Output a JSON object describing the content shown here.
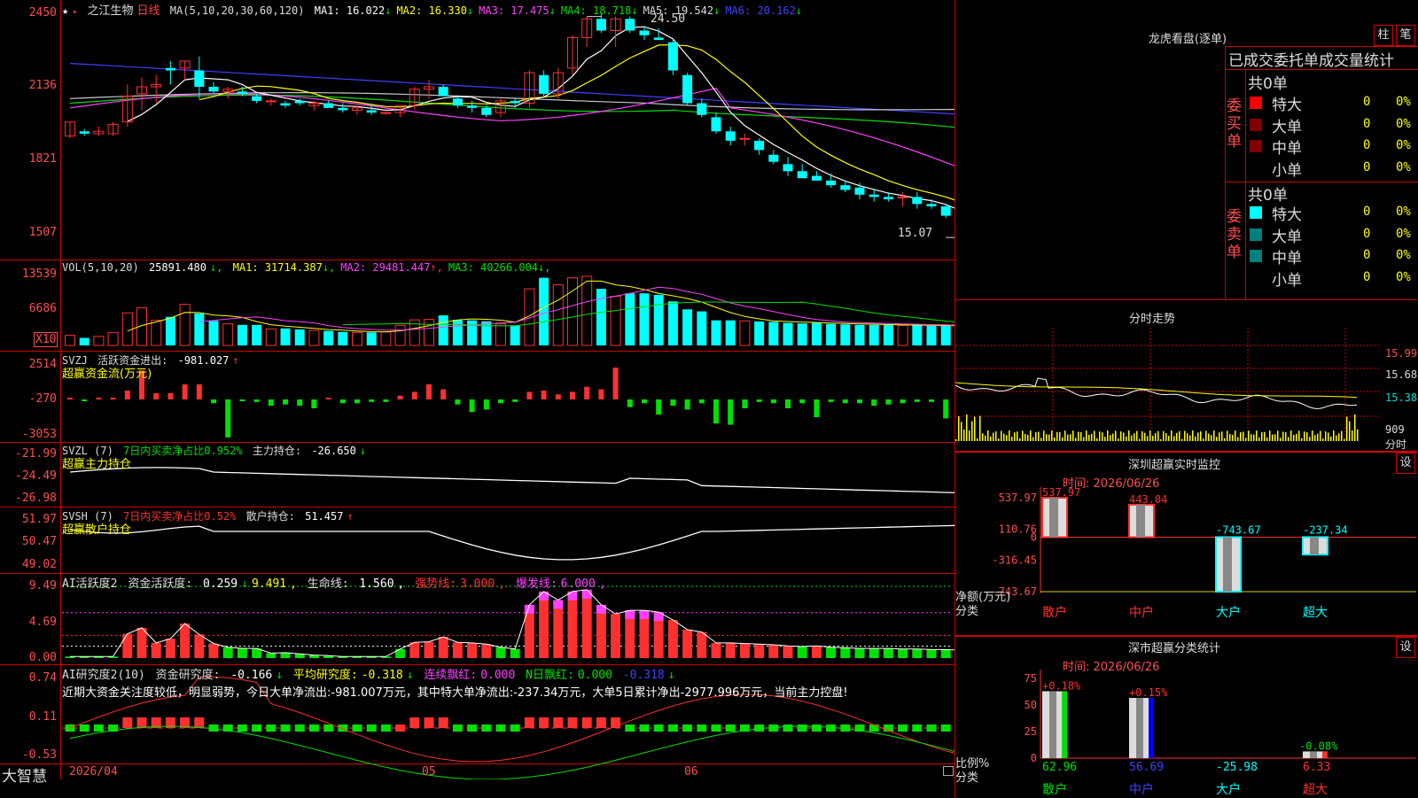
{
  "stock": {
    "name": "之江生物",
    "period": "日线"
  },
  "colors": {
    "up": "#ff3030",
    "down": "#00ffff",
    "green": "#00e000",
    "yellow": "#ffff00",
    "magenta": "#ff40ff",
    "white": "#ffffff",
    "grid": "#cc0000",
    "ma6": "#4040ff"
  },
  "price_panel": {
    "ma_label": "MA(5,10,20,30,60,120)",
    "ma": [
      {
        "name": "MA1:",
        "value": "16.022",
        "arrow": "↓",
        "color": "#ffffff"
      },
      {
        "name": "MA2:",
        "value": "16.330",
        "arrow": "↓",
        "color": "#ffff00"
      },
      {
        "name": "MA3:",
        "value": "17.475",
        "arrow": "↓",
        "color": "#ff40ff"
      },
      {
        "name": "MA4:",
        "value": "18.718",
        "arrow": "↓",
        "color": "#00e000"
      },
      {
        "name": "MA5:",
        "value": "19.542",
        "arrow": "↓",
        "color": "#dddddd"
      },
      {
        "name": "MA6:",
        "value": "20.162",
        "arrow": "↓",
        "color": "#4040ff"
      }
    ],
    "y_ticks": [
      "2450",
      "2136",
      "1821",
      "1507"
    ],
    "high_label": "24.50",
    "low_label": "15.07"
  },
  "vol_panel": {
    "label": "VOL(5,10,20)",
    "value": "25891.480",
    "ma": [
      {
        "name": "MA1:",
        "value": "31714.387",
        "arrow": "↓",
        "color": "#ffff00"
      },
      {
        "name": "MA2:",
        "value": "29481.447",
        "arrow": "↑",
        "color": "#ff40ff"
      },
      {
        "name": "MA3:",
        "value": "40266.004",
        "arrow": "↓",
        "color": "#00e000"
      }
    ],
    "y_ticks": [
      "13539",
      "6686"
    ],
    "unit": "X10"
  },
  "svzj_panel": {
    "label": "SVZJ",
    "name": "活跃资金进出:",
    "value": "-981.027",
    "arrow": "↑",
    "subtitle": "超赢资金流(万元)",
    "y_ticks": [
      "2514",
      "-270",
      "-3053"
    ]
  },
  "svzl_panel": {
    "label": "SVZL (7)",
    "name": "7日内买卖净占比0.952%",
    "name2": "主力持仓:",
    "value": "-26.650",
    "arrow": "↓",
    "subtitle": "超赢主力持仓",
    "y_ticks": [
      "-21.99",
      "-24.49",
      "-26.98"
    ]
  },
  "svsh_panel": {
    "label": "SVSH (7)",
    "name": "7日内买卖净占比0.52%",
    "name2": "散户持仓:",
    "value": "51.457",
    "arrow": "↑",
    "subtitle": "超赢散户持仓",
    "y_ticks": [
      "51.97",
      "50.47",
      "49.02"
    ]
  },
  "ai2_panel": {
    "label": "AI活跃度2",
    "name": "资金活跃度:",
    "value": "0.259",
    "arrow": "↓",
    "v2": "9.491",
    "name3": "生命线:",
    "v3": "1.560",
    "strong": "强势线:",
    "strong_v": "3.000",
    "burst": "爆发线:",
    "burst_v": "6.000",
    "y_ticks": [
      "9.49",
      "4.69",
      "0.00"
    ]
  },
  "ai_research_panel": {
    "label": "AI研究度2(10)",
    "name": "资金研究度:",
    "value": "-0.166",
    "arrow": "↓",
    "avg": "平均研究度:",
    "avg_v": "-0.318",
    "avg_arrow": "↓",
    "red": "连续飘红:",
    "red_v": "0.000",
    "nred": "N日飘红:",
    "nred_v": "0.000",
    "extra": "-0.318",
    "extra_arrow": "↓",
    "text": "近期大资金关注度较低，明显弱势，今日大单净流出:-981.007万元，其中特大单净流出:-237.34万元，大单5日累计净出-2977.996万元，当前主力控盘!",
    "y_ticks": [
      "0.74",
      "0.11",
      "-0.53"
    ]
  },
  "date_axis": {
    "d1": "2026/04",
    "d2": "05",
    "d3": "06"
  },
  "brand": "大智慧",
  "longhu": {
    "title": "龙虎看盘(逐单)",
    "btn1": "柱",
    "btn2": "笔",
    "subtitle": "已成交委托单成交量统计",
    "buy_side": "委买单",
    "sell_side": "委卖单",
    "buy_total": "共0单",
    "sell_total": "共0单",
    "rows": [
      "特大",
      "大单",
      "中单",
      "小单"
    ],
    "buy_colors": [
      "#ff0000",
      "#800000",
      "#800000",
      "#000000"
    ],
    "sell_colors": [
      "#00ffff",
      "#008080",
      "#008080",
      "#000000"
    ],
    "count": "0",
    "pct": "0%"
  },
  "minute": {
    "title": "分时走势",
    "prices": [
      "15.99",
      "15.68",
      "15.38"
    ],
    "vol": "909",
    "label": "分时"
  },
  "sz_monitor": {
    "title": "深圳超赢实时监控",
    "btn": "设",
    "time": "时间: 2026/06/26",
    "y_ticks": [
      "537.97",
      "110.76",
      "0",
      "-316.45",
      "-743.67"
    ],
    "bars": [
      {
        "cat": "散户",
        "value": 537.97,
        "label": "537.97"
      },
      {
        "cat": "中户",
        "value": 443.04,
        "label": "443.04"
      },
      {
        "cat": "大户",
        "value": -743.67,
        "label": "-743.67"
      },
      {
        "cat": "超大",
        "value": -237.34,
        "label": "-237.34"
      }
    ],
    "ylabel": "净额(万元)",
    "xlabel": "分类"
  },
  "sz_class": {
    "title": "深市超赢分类统计",
    "btn": "设",
    "time": "时间: 2026/06/26",
    "y_ticks": [
      "75",
      "50",
      "25",
      "0"
    ],
    "bars": [
      {
        "cat": "散户",
        "pct": "+0.18%",
        "value": "62.96",
        "h": 62.96
      },
      {
        "cat": "中户",
        "pct": "+0.15%",
        "value": "56.69",
        "h": 56.69
      },
      {
        "cat": "大户",
        "pct": "",
        "value": "-25.98",
        "h": 0
      },
      {
        "cat": "超大",
        "pct": "-0.08%",
        "value": "6.33",
        "h": 6.33
      }
    ],
    "ylabel": "比例%",
    "xlabel": "分类"
  },
  "chart_data": {
    "type": "candlestick",
    "candles": [
      [
        19.4,
        20.0,
        19.3,
        20.0
      ],
      [
        19.6,
        19.7,
        19.4,
        19.5
      ],
      [
        19.5,
        19.8,
        19.4,
        19.6
      ],
      [
        19.5,
        20.0,
        19.4,
        19.9
      ],
      [
        20.0,
        21.6,
        19.8,
        21.1
      ],
      [
        21.2,
        21.9,
        20.5,
        21.5
      ],
      [
        21.5,
        22.0,
        20.8,
        21.6
      ],
      [
        22.3,
        22.6,
        21.6,
        22.2
      ],
      [
        22.3,
        22.6,
        21.8,
        22.6
      ],
      [
        22.2,
        22.8,
        21.0,
        21.5
      ],
      [
        21.5,
        21.7,
        21.2,
        21.3
      ],
      [
        21.3,
        21.5,
        21.0,
        21.4
      ],
      [
        21.3,
        21.5,
        21.1,
        21.2
      ],
      [
        21.1,
        21.2,
        20.8,
        20.9
      ],
      [
        20.9,
        21.0,
        20.7,
        20.9
      ],
      [
        20.8,
        20.9,
        20.6,
        20.7
      ],
      [
        20.9,
        21.0,
        20.7,
        20.8
      ],
      [
        20.7,
        20.9,
        20.5,
        20.8
      ],
      [
        20.8,
        20.9,
        20.6,
        20.6
      ],
      [
        20.6,
        20.8,
        20.4,
        20.5
      ],
      [
        20.5,
        20.7,
        20.3,
        20.6
      ],
      [
        20.5,
        20.8,
        20.3,
        20.4
      ],
      [
        20.4,
        20.6,
        20.3,
        20.4
      ],
      [
        20.4,
        20.7,
        20.2,
        20.7
      ],
      [
        20.7,
        21.5,
        20.5,
        21.4
      ],
      [
        21.4,
        21.8,
        21.0,
        21.5
      ],
      [
        21.5,
        21.6,
        21.1,
        21.1
      ],
      [
        21.0,
        21.1,
        20.6,
        20.7
      ],
      [
        20.7,
        20.9,
        20.4,
        20.6
      ],
      [
        20.6,
        20.7,
        20.2,
        20.3
      ],
      [
        20.4,
        21.0,
        20.2,
        20.9
      ],
      [
        20.9,
        21.0,
        20.6,
        20.8
      ],
      [
        20.8,
        22.2,
        20.6,
        22.1
      ],
      [
        22.0,
        22.2,
        21.1,
        21.2
      ],
      [
        21.2,
        22.3,
        21.0,
        22.1
      ],
      [
        22.3,
        23.7,
        22.0,
        23.6
      ],
      [
        23.6,
        24.5,
        23.2,
        24.4
      ],
      [
        24.4,
        24.6,
        23.8,
        23.9
      ],
      [
        23.9,
        24.5,
        23.2,
        24.4
      ],
      [
        24.4,
        24.5,
        23.8,
        23.9
      ],
      [
        23.9,
        24.1,
        23.5,
        23.7
      ],
      [
        23.6,
        24.0,
        23.5,
        23.5
      ],
      [
        23.4,
        23.5,
        22.0,
        22.2
      ],
      [
        22.0,
        22.1,
        20.7,
        20.8
      ],
      [
        20.8,
        21.0,
        20.2,
        20.3
      ],
      [
        20.2,
        20.4,
        19.5,
        19.6
      ],
      [
        19.6,
        19.8,
        19.0,
        19.2
      ],
      [
        19.3,
        19.5,
        19.0,
        19.3
      ],
      [
        19.2,
        19.3,
        18.6,
        18.8
      ],
      [
        18.6,
        18.8,
        18.2,
        18.3
      ],
      [
        18.2,
        18.5,
        17.7,
        17.9
      ],
      [
        17.9,
        18.2,
        17.6,
        17.6
      ],
      [
        17.7,
        17.9,
        17.5,
        17.5
      ],
      [
        17.5,
        17.8,
        17.2,
        17.3
      ],
      [
        17.3,
        17.5,
        17.0,
        17.1
      ],
      [
        17.2,
        17.4,
        16.7,
        16.9
      ],
      [
        16.9,
        17.1,
        16.6,
        16.8
      ],
      [
        16.8,
        17.0,
        16.6,
        16.7
      ],
      [
        16.8,
        17.0,
        16.4,
        16.8
      ],
      [
        16.8,
        17.0,
        16.3,
        16.5
      ],
      [
        16.5,
        16.7,
        16.3,
        16.4
      ],
      [
        16.4,
        16.5,
        15.9,
        16.0
      ],
      [
        16.0,
        16.2,
        15.1,
        15.4
      ]
    ],
    "volume": [
      2000,
      1500,
      1800,
      2600,
      6500,
      7500,
      5000,
      5700,
      8200,
      6400,
      4900,
      4300,
      4100,
      4100,
      3300,
      3400,
      3200,
      3000,
      2900,
      2700,
      2600,
      2600,
      2700,
      4000,
      5100,
      5200,
      6000,
      5100,
      5000,
      4800,
      4300,
      4000,
      11300,
      13500,
      12100,
      13500,
      13800,
      11300,
      9800,
      10400,
      10400,
      10100,
      8800,
      7200,
      6800,
      5000,
      5000,
      4900,
      4800,
      4700,
      4500,
      4400,
      4500,
      4300,
      4200,
      4100,
      4100,
      4100,
      4000,
      4000,
      3900,
      3900,
      3800
    ],
    "svzj": [
      0,
      -100,
      0,
      0,
      700,
      2300,
      500,
      500,
      1200,
      1200,
      -300,
      -3000,
      -100,
      -200,
      -500,
      -400,
      -500,
      -700,
      0,
      -300,
      -300,
      -200,
      -200,
      300,
      600,
      1200,
      800,
      -400,
      -1000,
      -800,
      -300,
      -200,
      600,
      700,
      400,
      600,
      1000,
      800,
      2514,
      -600,
      -300,
      -1200,
      -500,
      -800,
      -300,
      -1900,
      -2000,
      -700,
      -200,
      -300,
      -700,
      -300,
      -1400,
      -200,
      -300,
      -300,
      -500,
      -400,
      -300,
      -200,
      -200,
      -1500,
      -800
    ]
  }
}
